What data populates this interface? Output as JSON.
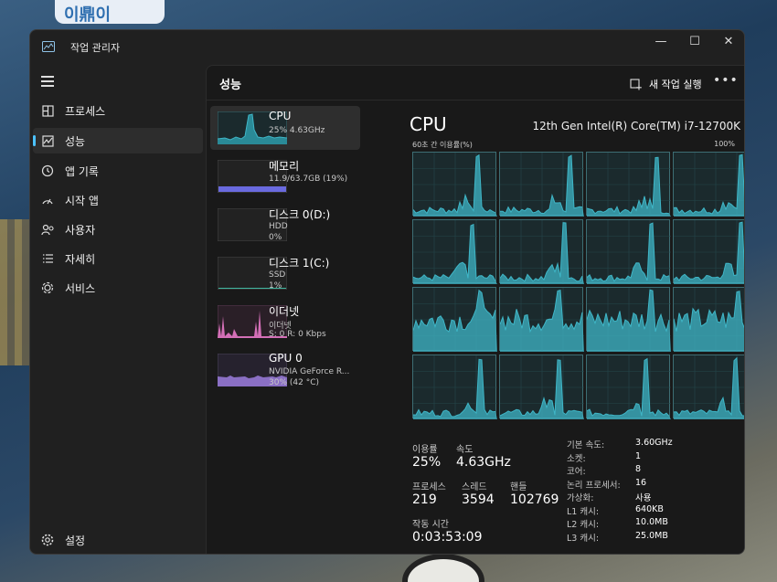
{
  "window": {
    "title": "작업 관리자"
  },
  "sidebar": {
    "items": [
      {
        "label": "프로세스",
        "icon": "grid-icon"
      },
      {
        "label": "성능",
        "icon": "performance-icon"
      },
      {
        "label": "앱 기록",
        "icon": "history-icon"
      },
      {
        "label": "시작 앱",
        "icon": "speedometer-icon"
      },
      {
        "label": "사용자",
        "icon": "users-icon"
      },
      {
        "label": "자세히",
        "icon": "list-icon"
      },
      {
        "label": "서비스",
        "icon": "puzzle-icon"
      }
    ],
    "settings": "설정"
  },
  "header": {
    "title": "성능",
    "run_task": "새 작업 실행"
  },
  "resources": [
    {
      "name": "CPU",
      "line1": "25% 4.63GHz",
      "line2": ""
    },
    {
      "name": "메모리",
      "line1": "11.9/63.7GB (19%)",
      "line2": ""
    },
    {
      "name": "디스크 0(D:)",
      "line1": "HDD",
      "line2": "0%"
    },
    {
      "name": "디스크 1(C:)",
      "line1": "SSD",
      "line2": "1%"
    },
    {
      "name": "이더넷",
      "line1": "이더넷",
      "line2": "S: 0 R: 0 Kbps"
    },
    {
      "name": "GPU 0",
      "line1": "NVIDIA GeForce R...",
      "line2": "30% (42 °C)"
    }
  ],
  "cpu": {
    "title": "CPU",
    "model": "12th Gen Intel(R) Core(TM) i7-12700K",
    "graph_caption": "60초 간 이용률(%)",
    "graph_max": "100%",
    "core_count_graphs": 16
  },
  "stats": {
    "utilization_label": "이용률",
    "utilization": "25%",
    "speed_label": "속도",
    "speed": "4.63GHz",
    "processes_label": "프로세스",
    "processes": "219",
    "threads_label": "스레드",
    "threads": "3594",
    "handles_label": "핸들",
    "handles": "102769",
    "uptime_label": "작동 시간",
    "uptime": "0:03:53:09"
  },
  "specs": [
    {
      "label": "기본 속도:",
      "value": "3.60GHz"
    },
    {
      "label": "소켓:",
      "value": "1"
    },
    {
      "label": "코어:",
      "value": "8"
    },
    {
      "label": "논리 프로세서:",
      "value": "16"
    },
    {
      "label": "가상화:",
      "value": "사용"
    },
    {
      "label": "L1 캐시:",
      "value": "640KB"
    },
    {
      "label": "L2 캐시:",
      "value": "10.0MB"
    },
    {
      "label": "L3 캐시:",
      "value": "25.0MB"
    }
  ],
  "colors": {
    "cpu": "#3fb6c7",
    "memory": "#6a6adf",
    "ethernet": "#d46fb7",
    "gpu": "#8a6fc4"
  }
}
